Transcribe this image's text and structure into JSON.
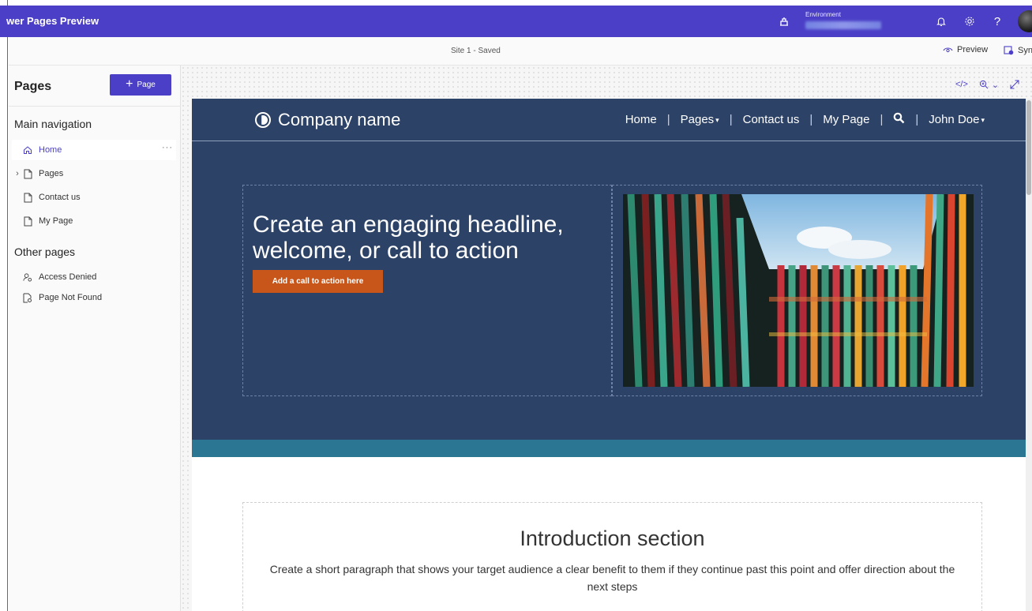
{
  "topbar": {
    "app_title": "wer Pages Preview",
    "environment_label": "Environment",
    "environment_icon": "environment-icon",
    "icons": [
      "bell-icon",
      "gear-icon",
      "help-icon"
    ],
    "brand_color": "#4b3fc7"
  },
  "subbar": {
    "site_status": "Site 1 - Saved",
    "preview_label": "Preview",
    "sync_label": "Sync"
  },
  "panel": {
    "title": "Pages",
    "add_page_label": "Page",
    "main_nav_title": "Main navigation",
    "main_nav_items": [
      {
        "label": "Home",
        "icon": "home-icon",
        "selected": true
      },
      {
        "label": "Pages",
        "icon": "page-icon",
        "expandable": true
      },
      {
        "label": "Contact us",
        "icon": "page-icon"
      },
      {
        "label": "My Page",
        "icon": "page-icon"
      }
    ],
    "other_pages_title": "Other pages",
    "other_pages_items": [
      {
        "label": "Access Denied",
        "icon": "person-lock-icon"
      },
      {
        "label": "Page Not Found",
        "icon": "page-search-icon"
      }
    ],
    "more_label": "···"
  },
  "canvas_tools": [
    "code-icon",
    "zoom-icon",
    "chevron-down-icon",
    "expand-icon"
  ],
  "site": {
    "brand": "Company name",
    "nav": [
      {
        "label": "Home"
      },
      {
        "label": "Pages",
        "caret": true
      },
      {
        "label": "Contact us"
      },
      {
        "label": "My Page"
      },
      {
        "label": "search-icon",
        "icon": true
      },
      {
        "label": "John Doe",
        "caret": true
      }
    ],
    "headline": "Create an engaging headline, welcome, or call to action",
    "cta_label": "Add a call to action here",
    "intro_title": "Introduction section",
    "intro_text": "Create a short paragraph that shows your target audience a clear benefit to them if they continue past this point and offer direction about the next steps",
    "colors": {
      "header_bg": "#2c4266",
      "band": "#2b7693",
      "cta": "#c8561a"
    }
  }
}
